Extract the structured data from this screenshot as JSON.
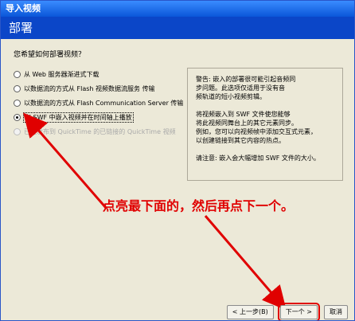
{
  "window": {
    "title": "导入视频"
  },
  "header": {
    "title": "部署"
  },
  "question": "您希望如何部署视频？",
  "options": [
    {
      "label": "从 Web 服务器渐进式下载",
      "selected": false,
      "disabled": false
    },
    {
      "label": "以数据流的方式从 Flash 视频数据流服务 传输",
      "selected": false,
      "disabled": false
    },
    {
      "label": "以数据流的方式从 Flash Communication Server 传输",
      "selected": false,
      "disabled": false
    },
    {
      "label": "在 SWF 中嵌入视频并在时间轴上播放",
      "selected": true,
      "disabled": false
    },
    {
      "label": "已经发布到 QuickTime 的已链接的 QuickTime 视频",
      "selected": false,
      "disabled": true
    }
  ],
  "description": "警告: 嵌入的部署很可能引起音频同\n步问题。此选项仅适用于没有音\n频轨道的短小视频剪辑。\n\n将视频嵌入到 SWF 文件使您能够\n将此视频同舞台上的其它元素同步。\n例如，您可以向视频帧中添加交互式元素，\n以创建链接到其它内容的热点。\n\n请注意: 嵌入会大幅增加 SWF 文件的大小。",
  "annotation": "点亮最下面的，然后再点下一个。",
  "buttons": {
    "back": "< 上一步(B)",
    "next": "下一个 >",
    "cancel": "取消"
  },
  "colors": {
    "accent": "#e00000",
    "header": "#0b46c8"
  }
}
